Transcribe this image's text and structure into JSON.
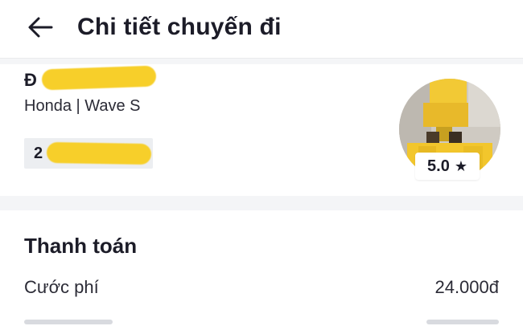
{
  "header": {
    "title": "Chi tiết chuyến đi",
    "back_icon": "arrow-left-icon"
  },
  "driver": {
    "name_visible": "Đ",
    "vehicle": "Honda | Wave S",
    "plate_visible": "2",
    "rating": "5.0",
    "rating_icon": "star-icon",
    "redaction_color": "#f7cf2a"
  },
  "payment": {
    "section_title": "Thanh toán",
    "fee_label": "Cước phí",
    "fee_value": "24.000đ"
  },
  "colors": {
    "text_primary": "#1c1c28",
    "background": "#f4f5f7",
    "card": "#ffffff"
  }
}
